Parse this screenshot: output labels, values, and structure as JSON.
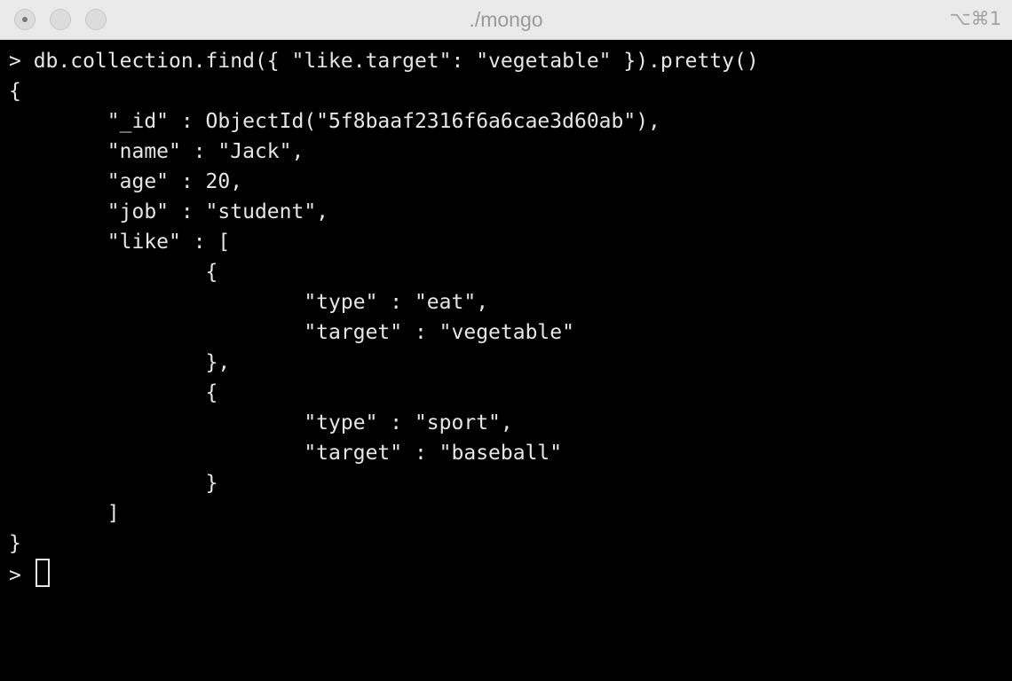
{
  "window": {
    "title": "./mongo",
    "shortcut": "⌥⌘1"
  },
  "terminal": {
    "lines": [
      "> db.collection.find({ \"like.target\": \"vegetable\" }).pretty()",
      "{",
      "        \"_id\" : ObjectId(\"5f8baaf2316f6a6cae3d60ab\"),",
      "        \"name\" : \"Jack\",",
      "        \"age\" : 20,",
      "        \"job\" : \"student\",",
      "        \"like\" : [",
      "                {",
      "                        \"type\" : \"eat\",",
      "                        \"target\" : \"vegetable\"",
      "                },",
      "                {",
      "                        \"type\" : \"sport\",",
      "                        \"target\" : \"baseball\"",
      "                }",
      "        ]",
      "}"
    ],
    "prompt": "> "
  }
}
